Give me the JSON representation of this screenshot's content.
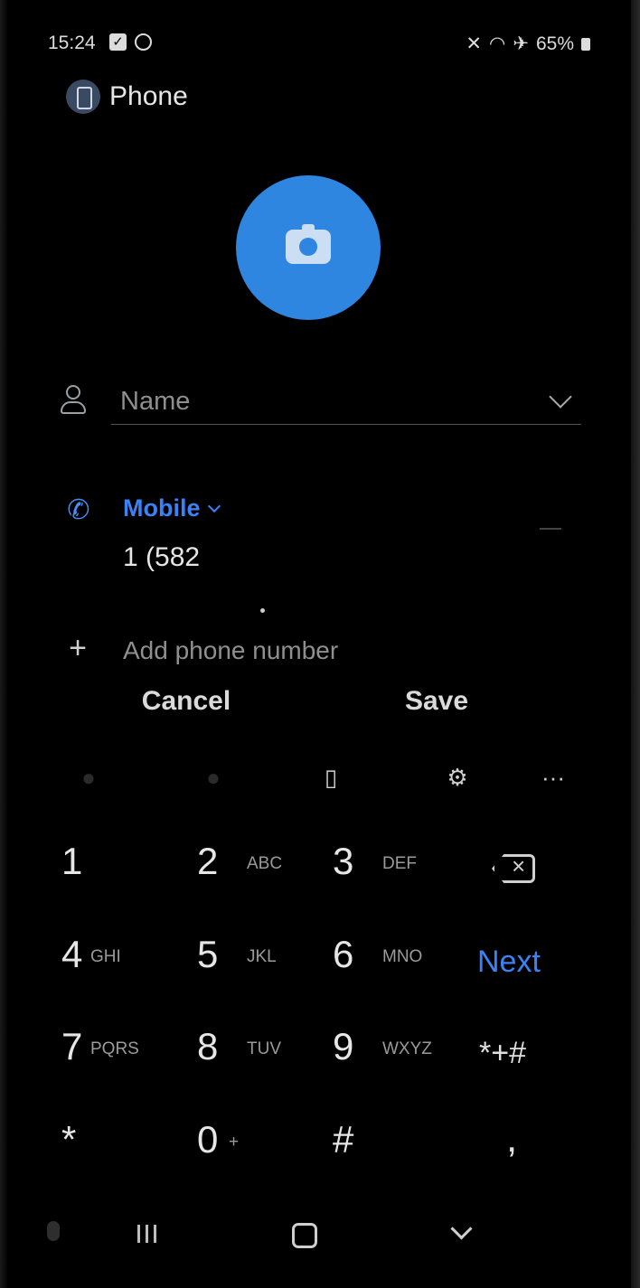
{
  "status_bar": {
    "time": "15:24",
    "battery": "65%",
    "icons": [
      "check-icon",
      "dnd-icon",
      "mute-icon",
      "wifi-icon",
      "airplane-icon",
      "battery-icon"
    ]
  },
  "header": {
    "title": "Phone"
  },
  "form": {
    "name_placeholder": "Name",
    "phone_label": "Mobile",
    "phone_value": "1 (582",
    "add_phone_label": "Add phone number"
  },
  "actions": {
    "cancel": "Cancel",
    "save": "Save"
  },
  "keypad": {
    "keys": [
      {
        "digit": "1",
        "letters": ""
      },
      {
        "digit": "2",
        "letters": "ABC"
      },
      {
        "digit": "3",
        "letters": "DEF"
      },
      {
        "digit": "4",
        "letters": "GHI"
      },
      {
        "digit": "5",
        "letters": "JKL"
      },
      {
        "digit": "6",
        "letters": "MNO"
      },
      {
        "digit": "7",
        "letters": "PQRS"
      },
      {
        "digit": "8",
        "letters": "TUV"
      },
      {
        "digit": "9",
        "letters": "WXYZ"
      },
      {
        "digit": "*",
        "letters": ""
      },
      {
        "digit": "0",
        "letters": "+"
      },
      {
        "digit": "#",
        "letters": ""
      }
    ],
    "next_label": "Next",
    "symbols_label": "*+#",
    "comma_label": ","
  },
  "colors": {
    "accent": "#3b82f6",
    "avatar": "#2f86e0",
    "background": "#000000"
  }
}
